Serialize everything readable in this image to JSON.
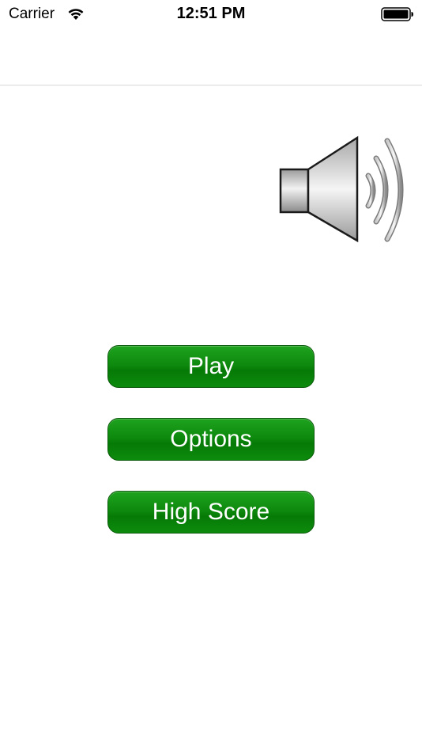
{
  "status_bar": {
    "carrier": "Carrier",
    "time": "12:51 PM",
    "wifi_icon": "wifi-icon",
    "battery_icon": "battery-icon"
  },
  "sound": {
    "icon": "speaker-icon",
    "state": "on"
  },
  "menu": {
    "play_label": "Play",
    "options_label": "Options",
    "high_score_label": "High Score"
  },
  "colors": {
    "button_green": "#0e8a0e",
    "button_text": "#ffffff",
    "background": "#ffffff",
    "divider": "#d9d9d9"
  }
}
